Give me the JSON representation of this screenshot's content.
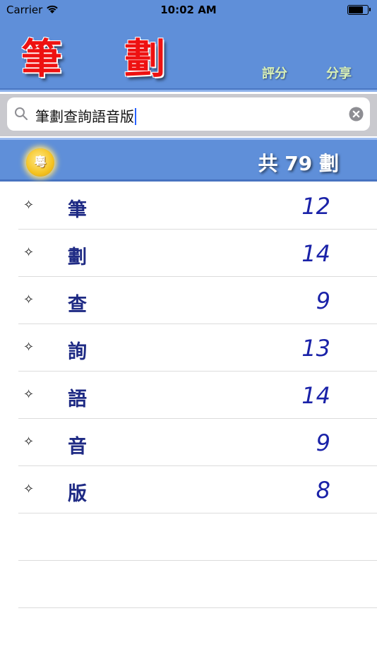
{
  "status_bar": {
    "carrier": "Carrier",
    "time": "10:02 AM",
    "battery_level": 0.8
  },
  "header": {
    "title": "筆 劃",
    "rate_label": "評分",
    "share_label": "分享"
  },
  "search": {
    "value": "筆劃查詢語音版"
  },
  "summary": {
    "cantonese_label": "粵",
    "total_label": "共 79 劃"
  },
  "list": {
    "items": [
      {
        "char": "筆",
        "strokes": "12"
      },
      {
        "char": "劃",
        "strokes": "14"
      },
      {
        "char": "查",
        "strokes": "9"
      },
      {
        "char": "詢",
        "strokes": "13"
      },
      {
        "char": "語",
        "strokes": "14"
      },
      {
        "char": "音",
        "strokes": "9"
      },
      {
        "char": "版",
        "strokes": "8"
      }
    ],
    "bullet": "✧"
  },
  "colors": {
    "header_bg": "#5f8fd9",
    "title_red": "#ee1111",
    "char_color": "#1e2a84",
    "count_color": "#1a22a8"
  }
}
